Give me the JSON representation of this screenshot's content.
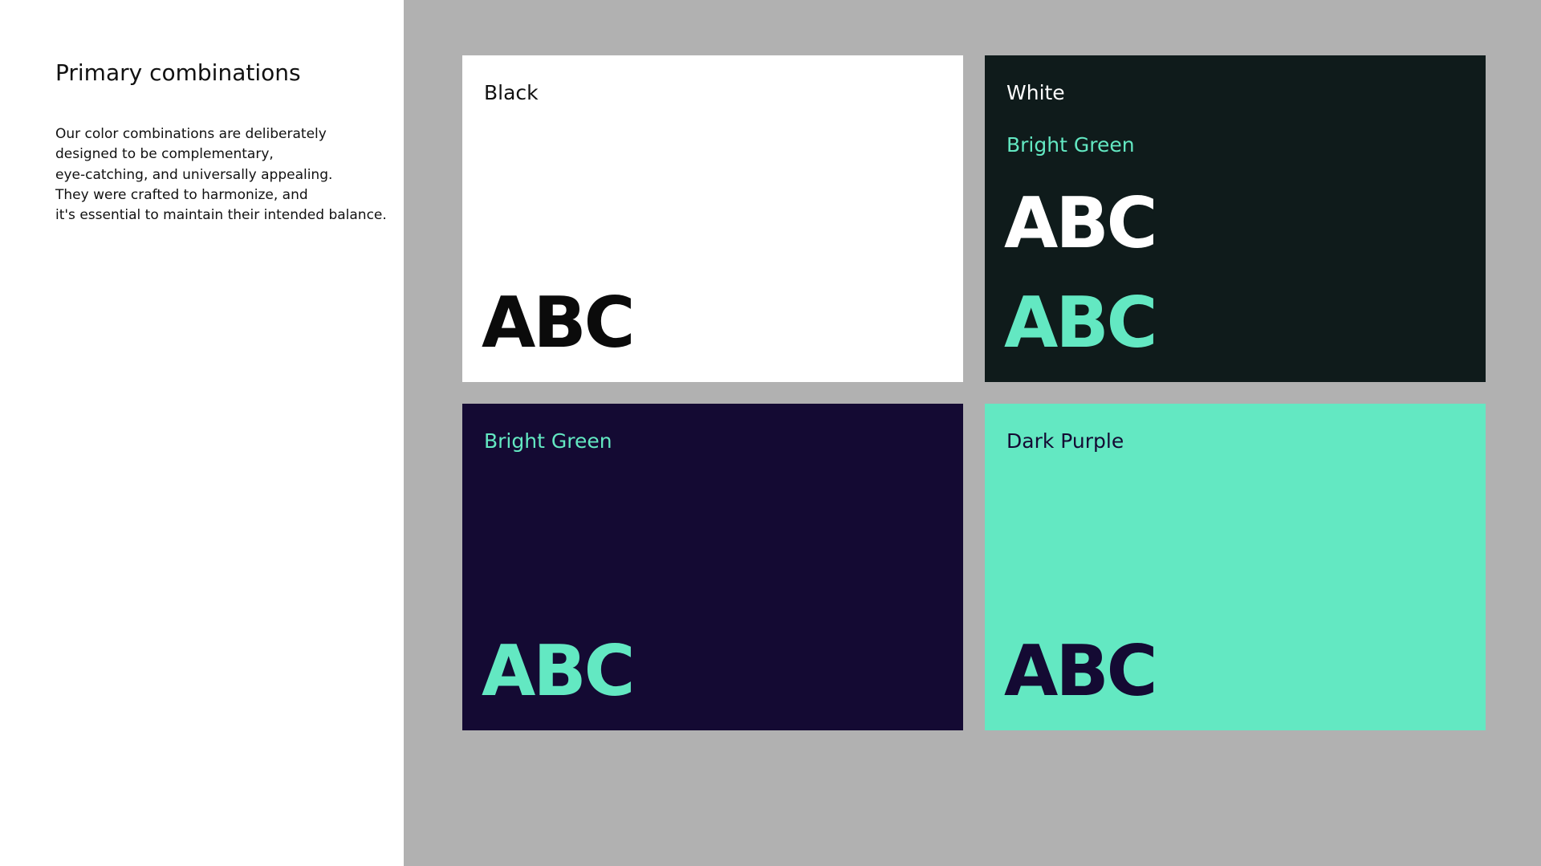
{
  "colors": {
    "page_background": "#ffffff",
    "gray_background": "#b1b1b1",
    "black": "#0b0b0b",
    "white": "#ffffff",
    "dark_green_black": "#0f1b1b",
    "bright_green": "#63e8c2",
    "dark_purple": "#140a33"
  },
  "sidebar": {
    "title": "Primary combinations",
    "description_lines": [
      "Our color combinations are deliberately",
      "designed to be complementary,",
      "eye-catching, and universally appealing.",
      "They were crafted to harmonize, and",
      "it's essential to maintain their intended balance."
    ]
  },
  "cards": [
    {
      "background": "#ffffff",
      "labels": [
        {
          "text": "Black",
          "color": "#111111"
        }
      ],
      "samples": [
        {
          "text": "ABC",
          "color": "#0b0b0b"
        }
      ]
    },
    {
      "background": "#0f1b1b",
      "labels": [
        {
          "text": "White",
          "color": "#ffffff"
        },
        {
          "text": "Bright Green",
          "color": "#63e8c2"
        }
      ],
      "samples": [
        {
          "text": "ABC",
          "color": "#ffffff"
        },
        {
          "text": "ABC",
          "color": "#63e8c2"
        }
      ]
    },
    {
      "background": "#140a33",
      "labels": [
        {
          "text": "Bright Green",
          "color": "#63e8c2"
        }
      ],
      "samples": [
        {
          "text": "ABC",
          "color": "#63e8c2"
        }
      ]
    },
    {
      "background": "#63e8c2",
      "labels": [
        {
          "text": "Dark Purple",
          "color": "#140a33"
        }
      ],
      "samples": [
        {
          "text": "ABC",
          "color": "#140a33"
        }
      ]
    }
  ]
}
